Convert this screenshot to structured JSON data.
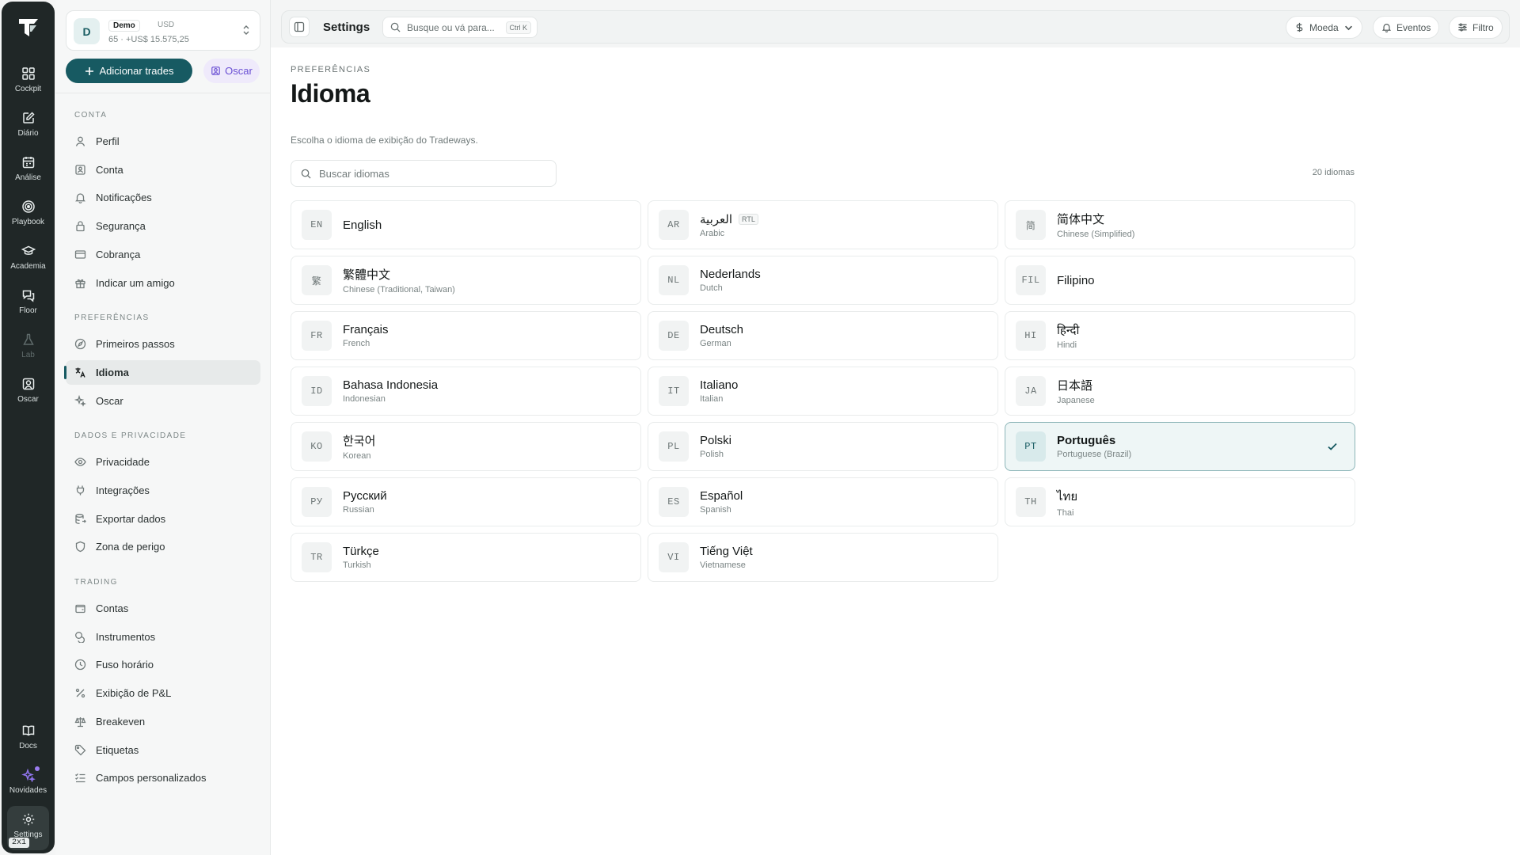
{
  "rail": {
    "items": [
      {
        "label": "Cockpit",
        "icon": "grid-icon"
      },
      {
        "label": "Diário",
        "icon": "journal-edit-icon"
      },
      {
        "label": "Análise",
        "icon": "calendar-icon"
      },
      {
        "label": "Playbook",
        "icon": "target-icon"
      },
      {
        "label": "Academia",
        "icon": "graduation-cap-icon"
      },
      {
        "label": "Floor",
        "icon": "chat-icon"
      },
      {
        "label": "Lab",
        "icon": "flask-icon"
      },
      {
        "label": "Oscar",
        "icon": "user-square-icon"
      },
      {
        "label": "Docs",
        "icon": "book-icon"
      },
      {
        "label": "Novidades",
        "icon": "sparkle-icon"
      },
      {
        "label": "Settings",
        "icon": "gear-icon"
      }
    ],
    "zoom_badge": "2x1"
  },
  "account": {
    "avatar": "D",
    "name": "Demo",
    "currency": "USD",
    "summary": "65 · +US$ 15.575,25"
  },
  "actions": {
    "add_trades": "Adicionar trades",
    "oscar": "Oscar"
  },
  "sidebar": {
    "sections": [
      {
        "title": "CONTA",
        "items": [
          "Perfil",
          "Conta",
          "Notificações",
          "Segurança",
          "Cobrança",
          "Indicar um amigo"
        ]
      },
      {
        "title": "PREFERÊNCIAS",
        "items": [
          "Primeiros passos",
          "Idioma",
          "Oscar"
        ]
      },
      {
        "title": "DADOS E PRIVACIDADE",
        "items": [
          "Privacidade",
          "Integrações",
          "Exportar dados",
          "Zona de perigo"
        ]
      },
      {
        "title": "TRADING",
        "items": [
          "Contas",
          "Instrumentos",
          "Fuso horário",
          "Exibição de P&L",
          "Breakeven",
          "Etiquetas",
          "Campos personalizados"
        ]
      }
    ],
    "active_item": "Idioma"
  },
  "topbar": {
    "title": "Settings",
    "search_placeholder": "Busque ou vá para...",
    "shortcut": "Ctrl K",
    "currency_btn": "Moeda",
    "events_btn": "Eventos",
    "filter_btn": "Filtro"
  },
  "page": {
    "eyebrow": "PREFERÊNCIAS",
    "title": "Idioma",
    "description": "Escolha o idioma de exibição do Tradeways.",
    "search_placeholder": "Buscar idiomas",
    "count": "20 idiomas"
  },
  "languages": [
    {
      "code": "EN",
      "native": "English",
      "english": ""
    },
    {
      "code": "AR",
      "native": "العربية",
      "english": "Arabic",
      "badge": "RTL"
    },
    {
      "code": "简",
      "native": "简体中文",
      "english": "Chinese (Simplified)"
    },
    {
      "code": "繁",
      "native": "繁體中文",
      "english": "Chinese (Traditional, Taiwan)"
    },
    {
      "code": "NL",
      "native": "Nederlands",
      "english": "Dutch"
    },
    {
      "code": "FIL",
      "native": "Filipino",
      "english": ""
    },
    {
      "code": "FR",
      "native": "Français",
      "english": "French"
    },
    {
      "code": "DE",
      "native": "Deutsch",
      "english": "German"
    },
    {
      "code": "HI",
      "native": "हिन्दी",
      "english": "Hindi"
    },
    {
      "code": "ID",
      "native": "Bahasa Indonesia",
      "english": "Indonesian"
    },
    {
      "code": "IT",
      "native": "Italiano",
      "english": "Italian"
    },
    {
      "code": "JA",
      "native": "日本語",
      "english": "Japanese"
    },
    {
      "code": "KO",
      "native": "한국어",
      "english": "Korean"
    },
    {
      "code": "PL",
      "native": "Polski",
      "english": "Polish"
    },
    {
      "code": "PT",
      "native": "Português",
      "english": "Portuguese (Brazil)",
      "selected": true
    },
    {
      "code": "РУ",
      "native": "Русский",
      "english": "Russian"
    },
    {
      "code": "ES",
      "native": "Español",
      "english": "Spanish"
    },
    {
      "code": "TH",
      "native": "ไทย",
      "english": "Thai"
    },
    {
      "code": "TR",
      "native": "Türkçe",
      "english": "Turkish"
    },
    {
      "code": "VI",
      "native": "Tiếng Việt",
      "english": "Vietnamese"
    }
  ],
  "colors": {
    "accent": "#175a62",
    "rail_bg": "#202727",
    "oscar_purple": "#6a4fd4"
  }
}
